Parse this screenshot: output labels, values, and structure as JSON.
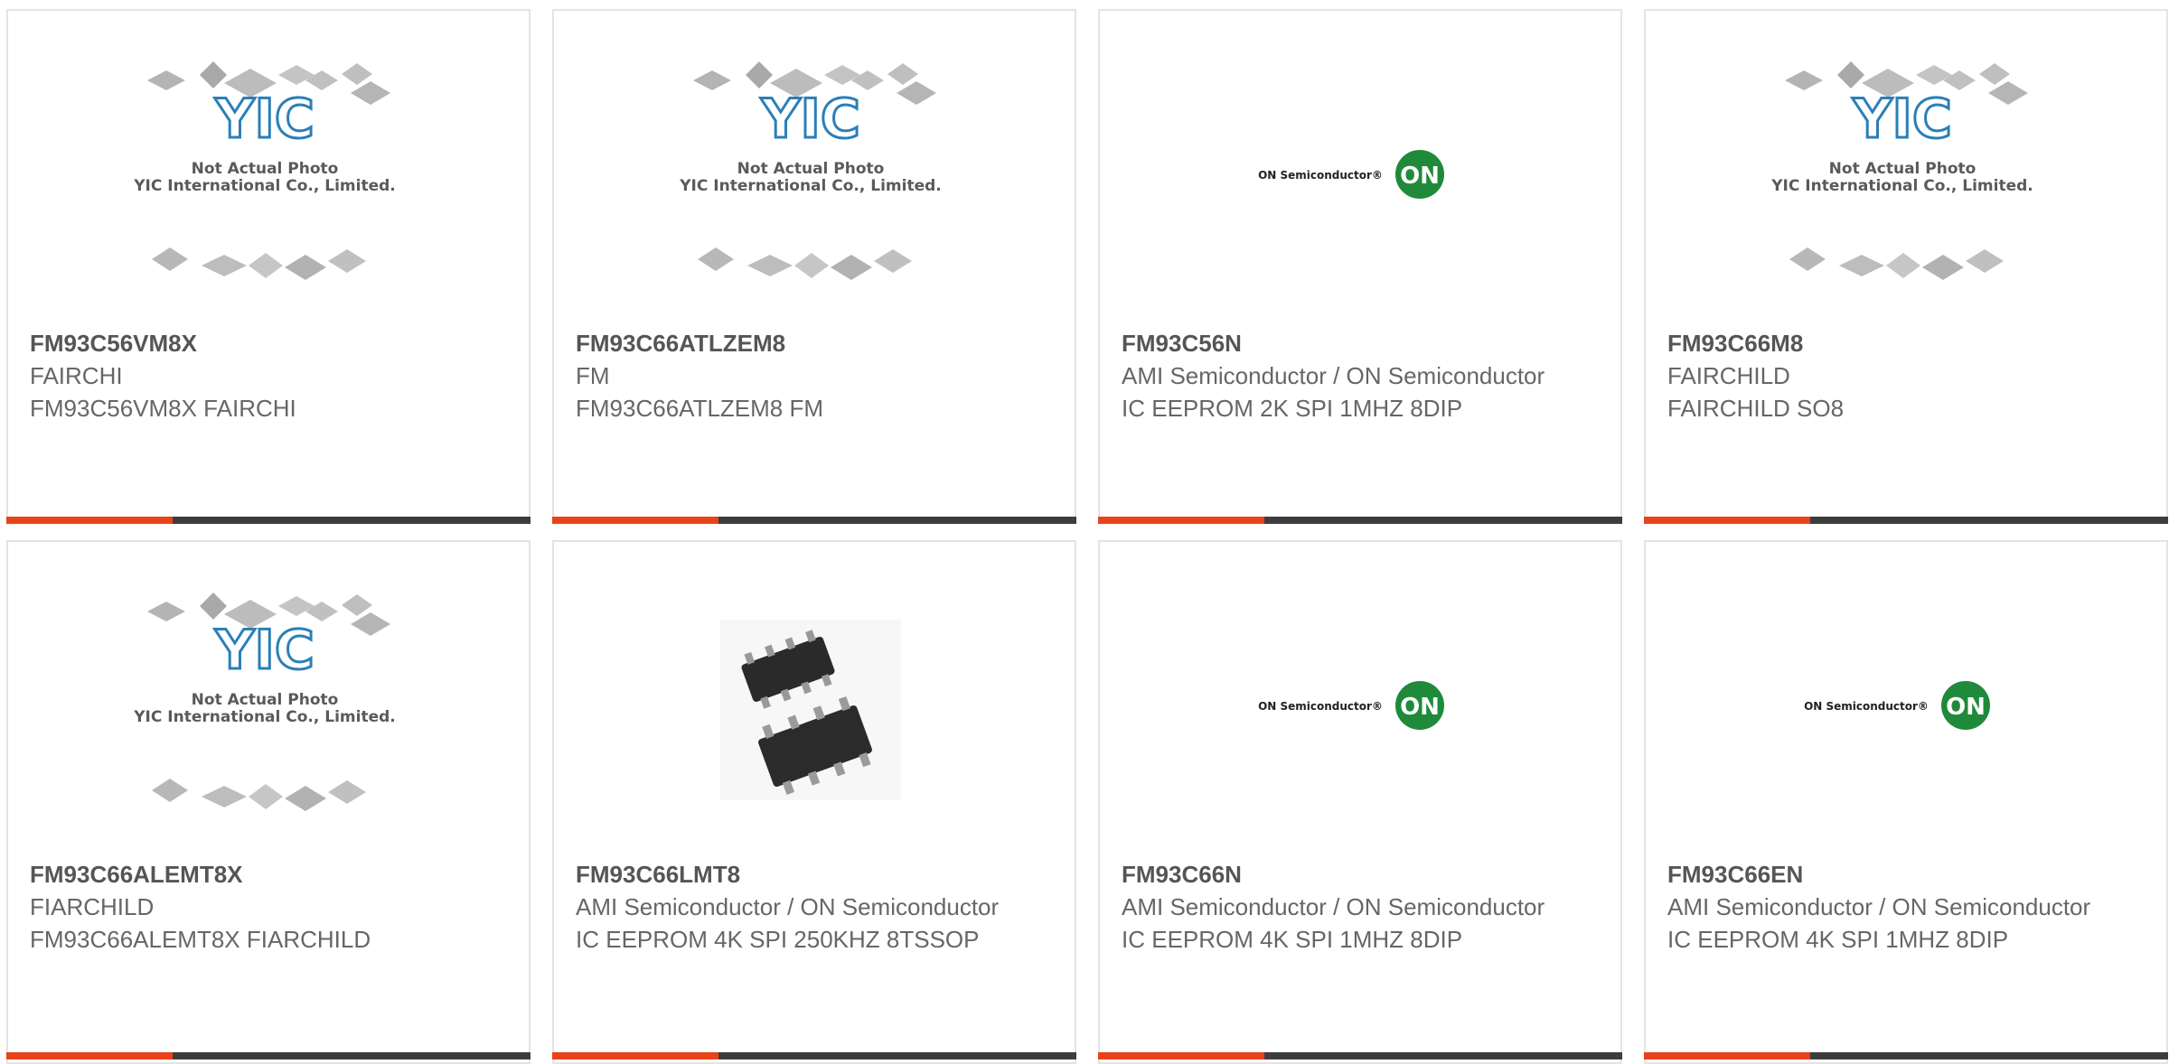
{
  "placeholder": {
    "brand": "YIC",
    "line1": "Not Actual Photo",
    "line2": "YIC International Co., Limited."
  },
  "on_logo": {
    "text": "ON Semiconductor",
    "badge": "ON"
  },
  "colors": {
    "accent": "#e8431a",
    "bar": "#3d3d3d",
    "on_green": "#1f8a3a",
    "yic_blue": "#2a7fb8"
  },
  "products": [
    {
      "part": "FM93C56VM8X",
      "manufacturer": "FAIRCHI",
      "description": "FM93C56VM8X FAIRCHI",
      "image": "yic-placeholder-icon"
    },
    {
      "part": "FM93C66ATLZEM8",
      "manufacturer": "FM",
      "description": "FM93C66ATLZEM8 FM",
      "image": "yic-placeholder-icon"
    },
    {
      "part": "FM93C56N",
      "manufacturer": "AMI Semiconductor / ON Semiconductor",
      "description": "IC EEPROM 2K SPI 1MHZ 8DIP",
      "image": "on-semiconductor-logo"
    },
    {
      "part": "FM93C66M8",
      "manufacturer": "FAIRCHILD",
      "description": "FAIRCHILD SO8",
      "image": "yic-placeholder-icon"
    },
    {
      "part": "FM93C66ALEMT8X",
      "manufacturer": "FIARCHILD",
      "description": "FM93C66ALEMT8X FIARCHILD",
      "image": "yic-placeholder-icon"
    },
    {
      "part": "FM93C66LMT8",
      "manufacturer": "AMI Semiconductor / ON Semiconductor",
      "description": "IC EEPROM 4K SPI 250KHZ 8TSSOP",
      "image": "tssop-chip-photo"
    },
    {
      "part": "FM93C66N",
      "manufacturer": "AMI Semiconductor / ON Semiconductor",
      "description": "IC EEPROM 4K SPI 1MHZ 8DIP",
      "image": "on-semiconductor-logo"
    },
    {
      "part": "FM93C66EN",
      "manufacturer": "AMI Semiconductor / ON Semiconductor",
      "description": "IC EEPROM 4K SPI 1MHZ 8DIP",
      "image": "on-semiconductor-logo"
    }
  ]
}
